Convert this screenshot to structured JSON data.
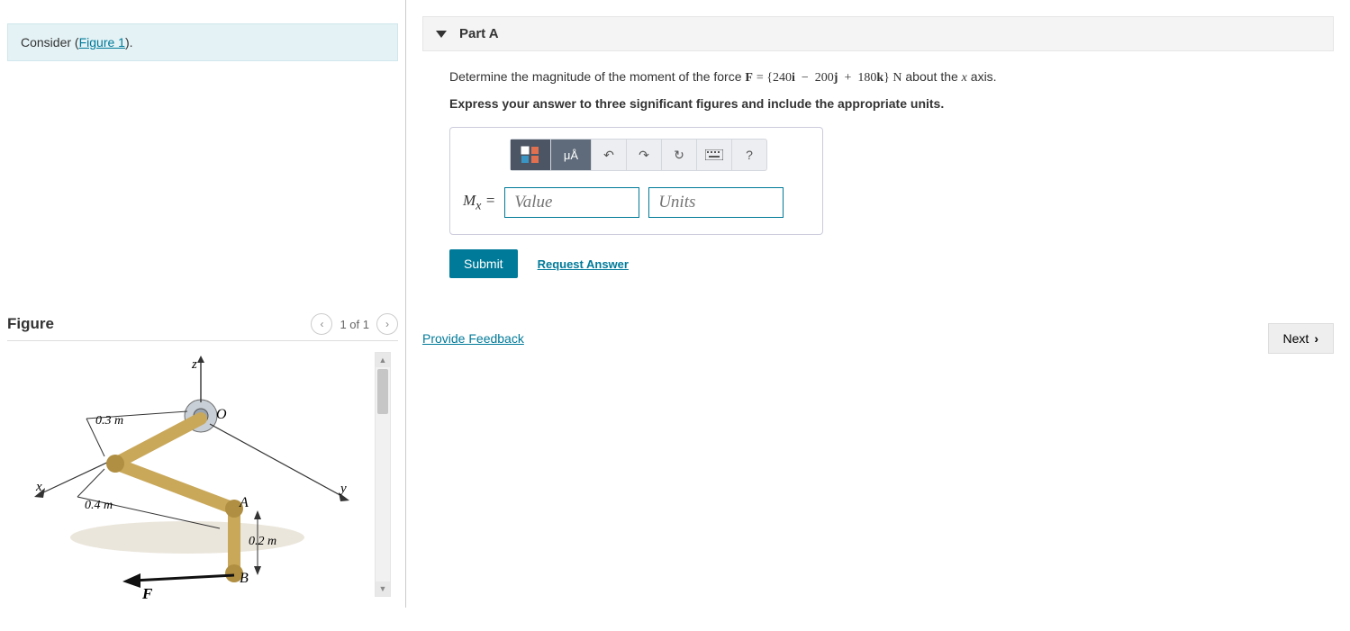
{
  "intro": {
    "prefix": "Consider (",
    "link": "Figure 1",
    "suffix": ")."
  },
  "figure": {
    "title": "Figure",
    "page": "1 of 1",
    "labels": {
      "z": "z",
      "x": "x",
      "y": "y",
      "O": "O",
      "A": "A",
      "B": "B",
      "F": "F",
      "d1": "0.3 m",
      "d2": "0.4 m",
      "d3": "0.2 m"
    }
  },
  "part": {
    "title": "Part A",
    "question_pre": "Determine the magnitude of the moment of the force ",
    "force_expr": "F = {240i − 200j + 180k} N",
    "question_post": " about the ",
    "axis": "x",
    "question_end": " axis.",
    "instruction": "Express your answer to three significant figures and include the appropriate units.",
    "mx_label": "Mₓ =",
    "value_ph": "Value",
    "units_ph": "Units",
    "toolbar": {
      "ua": "μÅ",
      "help": "?"
    }
  },
  "actions": {
    "submit": "Submit",
    "request": "Request Answer",
    "feedback": "Provide Feedback",
    "next": "Next"
  }
}
